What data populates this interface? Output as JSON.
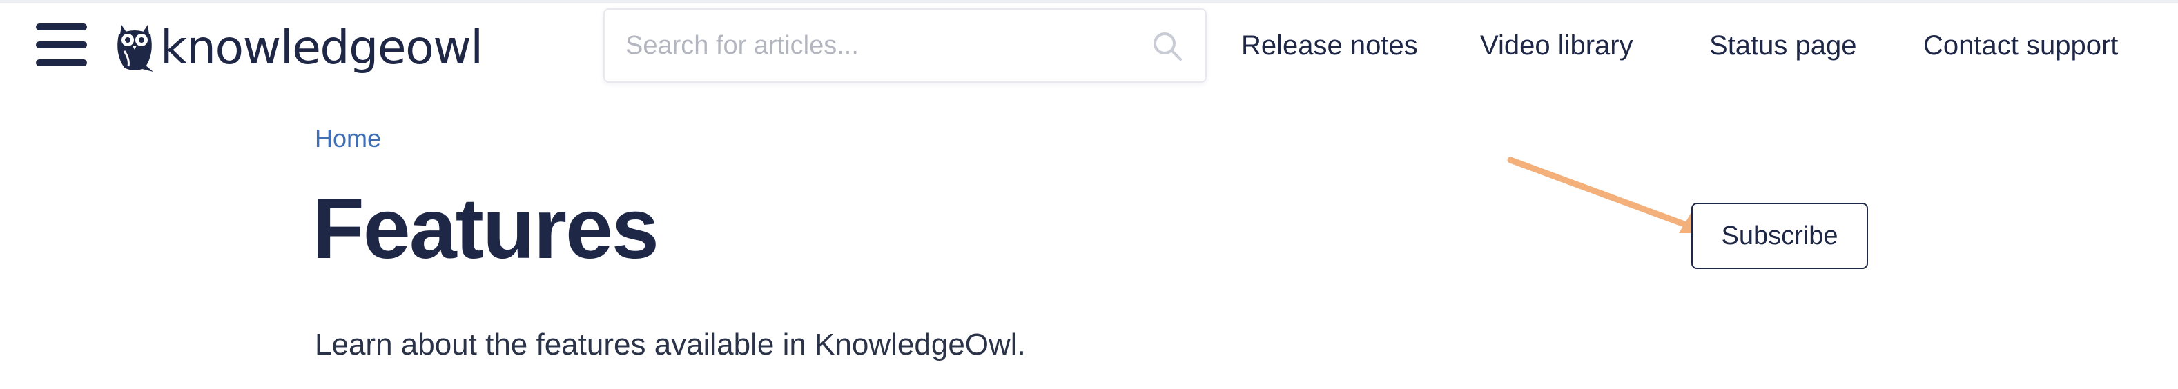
{
  "header": {
    "logo_text": "knowledgeowl",
    "search": {
      "placeholder": "Search for articles...",
      "value": ""
    },
    "nav": [
      {
        "label": "Release notes"
      },
      {
        "label": "Video library"
      },
      {
        "label": "Status page"
      },
      {
        "label": "Contact support"
      }
    ],
    "icons": {
      "menu": "hamburger-menu-icon",
      "search": "search-icon",
      "logo": "owl-logo-icon"
    }
  },
  "main": {
    "breadcrumb": "Home",
    "title": "Features",
    "description": "Learn about the features available in KnowledgeOwl.",
    "subscribe_label": "Subscribe"
  },
  "annotation": {
    "arrow_color": "#f3b07a"
  },
  "colors": {
    "navy": "#1f2747",
    "link": "#3f6fb5",
    "border": "#e7e9ee"
  }
}
